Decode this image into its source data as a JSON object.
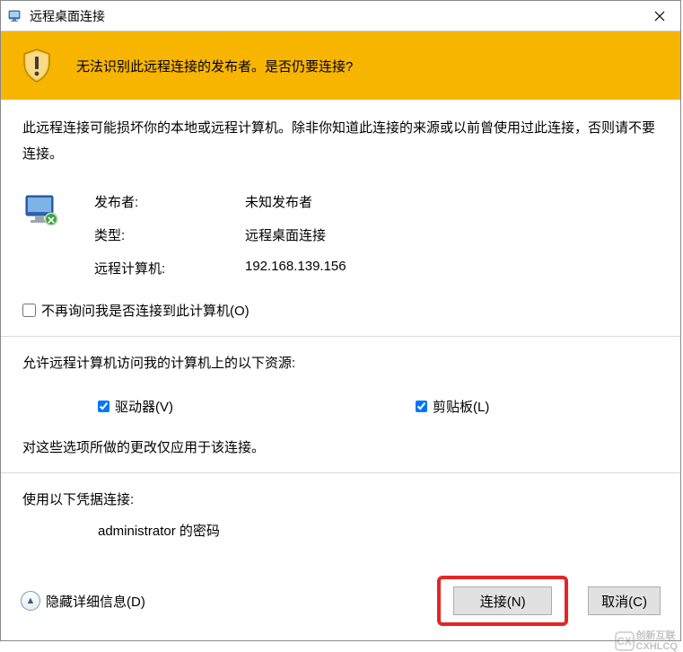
{
  "titlebar": {
    "title": "远程桌面连接"
  },
  "banner": {
    "text": "无法识别此远程连接的发布者。是否仍要连接?"
  },
  "warning_text": "此远程连接可能损坏你的本地或远程计算机。除非你知道此连接的来源或以前曾使用过此连接，否则请不要连接。",
  "info": {
    "publisher_label": "发布者:",
    "publisher_value": "未知发布者",
    "type_label": "类型:",
    "type_value": "远程桌面连接",
    "remote_label": "远程计算机:",
    "remote_value": "192.168.139.156"
  },
  "dont_ask": {
    "label": "不再询问我是否连接到此计算机(O)",
    "checked": false
  },
  "resources": {
    "intro": "允许远程计算机访问我的计算机上的以下资源:",
    "drives_label": "驱动器(V)",
    "drives_checked": true,
    "clipboard_label": "剪贴板(L)",
    "clipboard_checked": true,
    "note": "对这些选项所做的更改仅应用于该连接。"
  },
  "credentials": {
    "intro": "使用以下凭据连接:",
    "value": "administrator 的密码"
  },
  "footer": {
    "expand_label": "隐藏详细信息(D)",
    "connect_label": "连接(N)",
    "cancel_label": "取消(C)"
  },
  "watermark": {
    "brand1": "创新互联",
    "brand2": "CXHLCQ"
  }
}
